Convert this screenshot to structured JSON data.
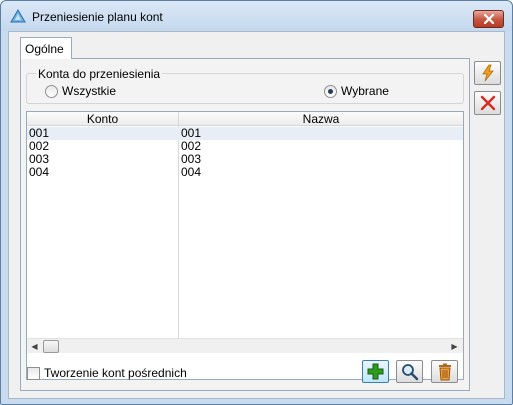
{
  "window": {
    "title": "Przeniesienie planu kont"
  },
  "tabs": [
    {
      "label": "Ogólne",
      "active": true
    }
  ],
  "group": {
    "label": "Konta do przeniesienia",
    "options": [
      {
        "label": "Wszystkie",
        "selected": false
      },
      {
        "label": "Wybrane",
        "selected": true
      }
    ]
  },
  "table": {
    "columns": [
      "Konto",
      "Nazwa"
    ],
    "rows": [
      {
        "konto": "001",
        "nazwa": "001",
        "selected": true
      },
      {
        "konto": "002",
        "nazwa": "002",
        "selected": false
      },
      {
        "konto": "003",
        "nazwa": "003",
        "selected": false
      },
      {
        "konto": "004",
        "nazwa": "004",
        "selected": false
      }
    ]
  },
  "checkbox": {
    "label": "Tworzenie kont pośrednich",
    "checked": false
  },
  "toolbar": {
    "icons": [
      "plus-icon",
      "magnifier-icon",
      "trash-icon"
    ]
  },
  "side_buttons": {
    "icons": [
      "lightning-icon",
      "close-x-icon"
    ]
  },
  "colors": {
    "close_red": "#c75a45",
    "add_green": "#2e9b1e",
    "cancel_red": "#d62b1f",
    "lightning_orange": "#f0a020"
  }
}
